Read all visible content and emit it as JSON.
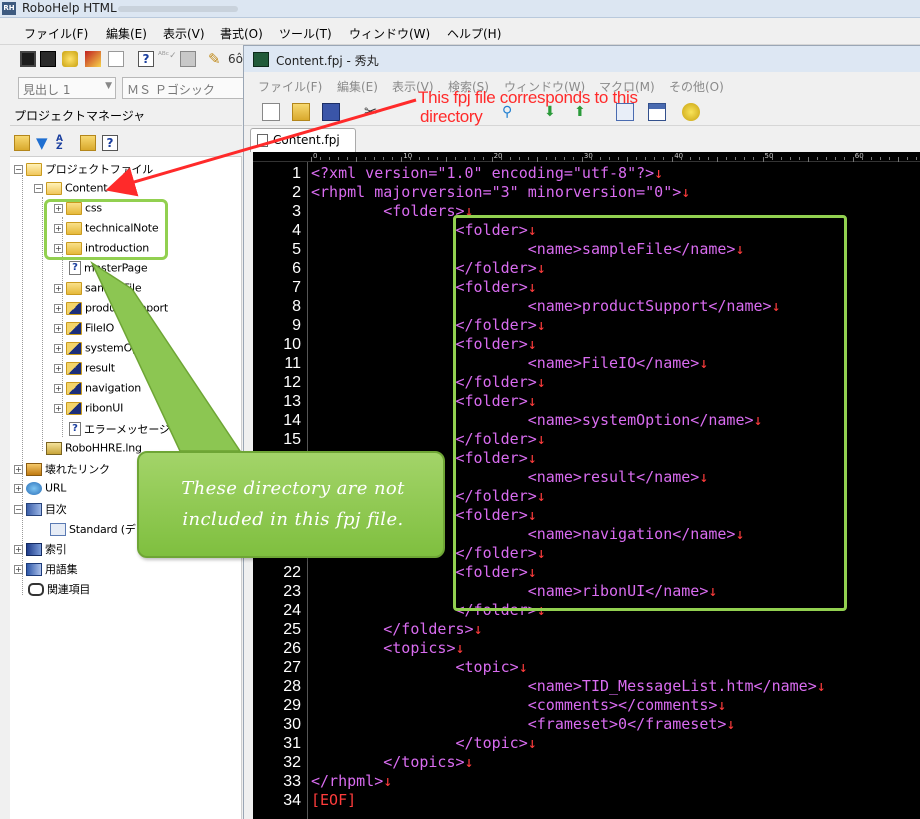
{
  "robohelp": {
    "title": "RoboHelp HTML",
    "menu": [
      "ファイル(F)",
      "編集(E)",
      "表示(V)",
      "書式(O)",
      "ツール(T)",
      "ウィンドウ(W)",
      "ヘルプ(H)"
    ],
    "style_combo": "見出し 1",
    "font_combo": "ＭＳ Ｐゴシック",
    "project_manager": {
      "title": "プロジェクトマネージャ",
      "tree": {
        "project_files": "プロジェクトファイル",
        "content": "Content",
        "children": [
          "css",
          "technicalNote",
          "introduction",
          "masterPage",
          "sampleFile",
          "productSupport",
          "FileIO",
          "systemOption",
          "result",
          "navigation",
          "ribonUI",
          "エラーメッセージと対処"
        ],
        "robohhre": "RoboHHRE.lng",
        "broken_links": "壊れたリンク",
        "url": "URL",
        "toc": "目次",
        "toc_standard": "Standard (デフ",
        "index": "索引",
        "glossary": "用語集",
        "related": "関連項目"
      }
    }
  },
  "hidemaru": {
    "title": "Content.fpj - 秀丸",
    "menu": [
      "ファイル(F)",
      "編集(E)",
      "表示(V)",
      "検索(S)",
      "ウィンドウ(W)",
      "マクロ(M)",
      "その他(O)"
    ],
    "tab": "Content.fpj",
    "ruler": [
      "0",
      "10",
      "20",
      "30",
      "40",
      "50",
      "60"
    ],
    "lines": [
      {
        "n": "1",
        "text": "<?xml version=\"1.0\" encoding=\"utf-8\"?>",
        "eol": "↓"
      },
      {
        "n": "2",
        "text": "<rhpml majorversion=\"3\" minorversion=\"0\">",
        "eol": "↓"
      },
      {
        "n": "3",
        "text": "        <folders>",
        "eol": "↓"
      },
      {
        "n": "4",
        "text": "                <folder>",
        "eol": "↓"
      },
      {
        "n": "5",
        "text": "                        <name>sampleFile</name>",
        "eol": "↓"
      },
      {
        "n": "6",
        "text": "                </folder>",
        "eol": "↓"
      },
      {
        "n": "7",
        "text": "                <folder>",
        "eol": "↓"
      },
      {
        "n": "8",
        "text": "                        <name>productSupport</name>",
        "eol": "↓"
      },
      {
        "n": "9",
        "text": "                </folder>",
        "eol": "↓"
      },
      {
        "n": "10",
        "text": "                <folder>",
        "eol": "↓"
      },
      {
        "n": "11",
        "text": "                        <name>FileIO</name>",
        "eol": "↓"
      },
      {
        "n": "12",
        "text": "                </folder>",
        "eol": "↓"
      },
      {
        "n": "13",
        "text": "                <folder>",
        "eol": "↓"
      },
      {
        "n": "14",
        "text": "                        <name>systemOption</name>",
        "eol": "↓"
      },
      {
        "n": "15",
        "text": "                </folder>",
        "eol": "↓"
      },
      {
        "n": "",
        "text": "                <folder>",
        "eol": "↓"
      },
      {
        "n": "",
        "text": "                        <name>result</name>",
        "eol": "↓"
      },
      {
        "n": "",
        "text": "                </folder>",
        "eol": "↓"
      },
      {
        "n": "",
        "text": "                <folder>",
        "eol": "↓"
      },
      {
        "n": "",
        "text": "                        <name>navigation</name>",
        "eol": "↓"
      },
      {
        "n": "",
        "text": "                </folder>",
        "eol": "↓"
      },
      {
        "n": "22",
        "text": "                <folder>",
        "eol": "↓"
      },
      {
        "n": "23",
        "text": "                        <name>ribonUI</name>",
        "eol": "↓"
      },
      {
        "n": "24",
        "text": "                </folder>",
        "eol": "↓"
      },
      {
        "n": "25",
        "text": "        </folders>",
        "eol": "↓"
      },
      {
        "n": "26",
        "text": "        <topics>",
        "eol": "↓"
      },
      {
        "n": "27",
        "text": "                <topic>",
        "eol": "↓"
      },
      {
        "n": "28",
        "text": "                        <name>TID_MessageList.htm</name>",
        "eol": "↓"
      },
      {
        "n": "29",
        "text": "                        <comments></comments>",
        "eol": "↓"
      },
      {
        "n": "30",
        "text": "                        <frameset>0</frameset>",
        "eol": "↓"
      },
      {
        "n": "31",
        "text": "                </topic>",
        "eol": "↓"
      },
      {
        "n": "32",
        "text": "        </topics>",
        "eol": "↓"
      },
      {
        "n": "33",
        "text": "</rhpml>",
        "eol": "↓"
      },
      {
        "n": "34",
        "text": "[EOF]",
        "eol": ""
      }
    ]
  },
  "annotations": {
    "red_note": [
      "This fpj file corresponds to this",
      "directory"
    ],
    "callout": [
      "These directory are not",
      "included in this fpj file."
    ]
  },
  "colors": {
    "annotation_green": "#92d050",
    "annotation_red": "#ff2a2a",
    "code_text": "#d96cf0",
    "eol_mark": "#ff3c3c"
  }
}
